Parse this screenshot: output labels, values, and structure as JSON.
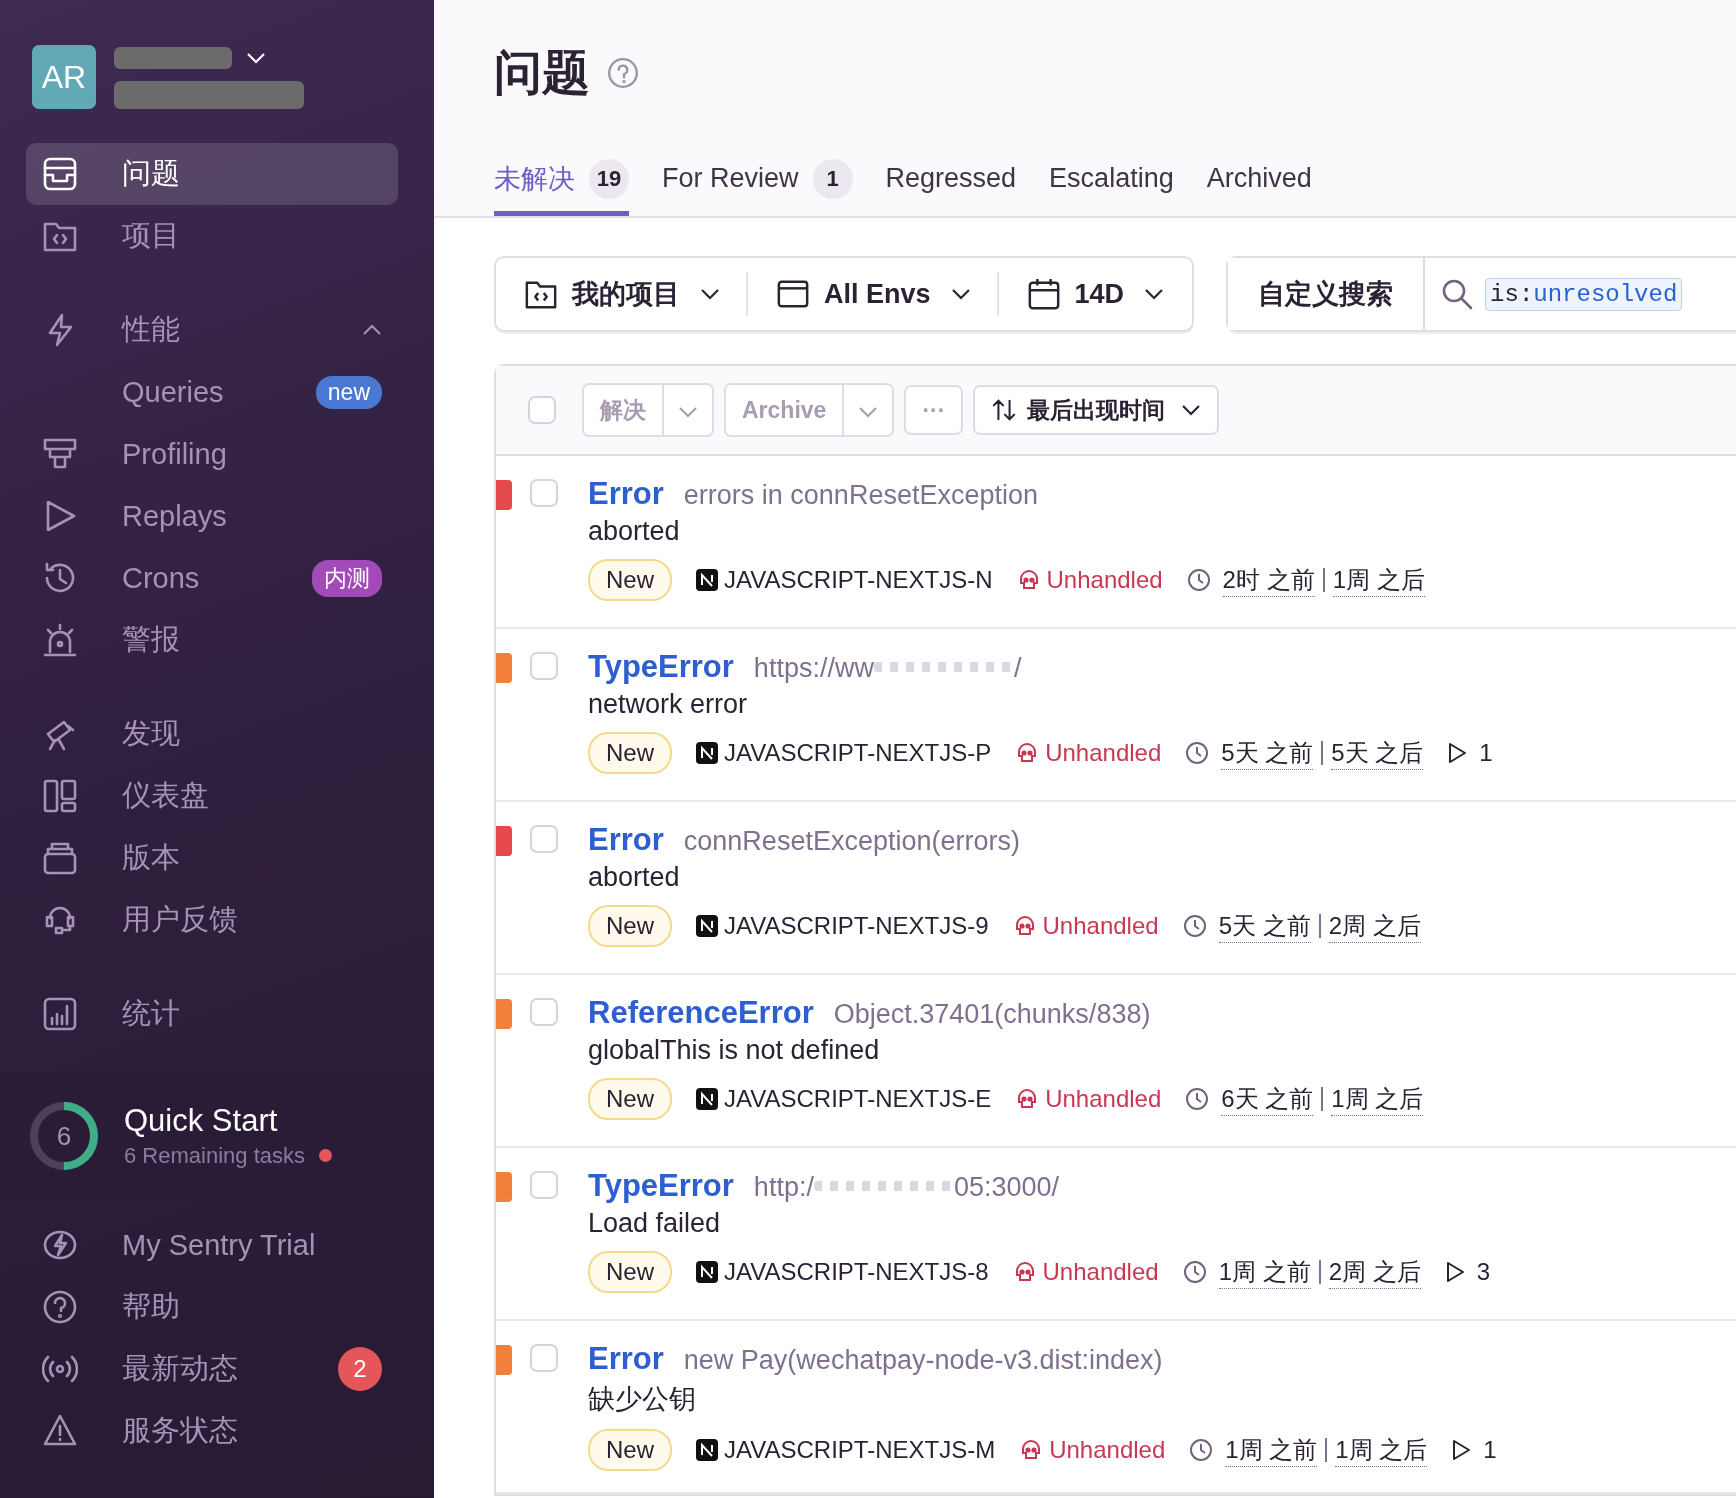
{
  "sidebar": {
    "avatar": "AR",
    "groups": [
      [
        {
          "label": "问题",
          "selected": true
        },
        {
          "label": "项目",
          "selected": false
        }
      ],
      [
        {
          "label": "性能",
          "selected": false,
          "expanded": true,
          "children": [
            {
              "label": "Queries",
              "selected": false,
              "badge": "new",
              "color": "#4a78d2"
            },
            {
              "label": "Profiling",
              "selected": false
            },
            {
              "label": "Replays",
              "selected": false
            },
            {
              "label": "Crons",
              "selected": false,
              "badge": "内测",
              "color": "#a24bb8"
            }
          ]
        },
        {
          "label": "警报",
          "selected": false
        }
      ],
      [
        {
          "label": "发现",
          "selected": false
        },
        {
          "label": "仪表盘",
          "selected": false
        },
        {
          "label": "版本",
          "selected": false
        },
        {
          "label": "用户反馈",
          "selected": false
        }
      ],
      [
        {
          "label": "统计",
          "selected": false
        }
      ]
    ],
    "quick_start": {
      "count": "6",
      "title": "Quick Start",
      "subtitle": "6 Remaining tasks",
      "unread": true
    },
    "bottom_items": [
      {
        "label": "My Sentry Trial"
      },
      {
        "label": "帮助"
      },
      {
        "label": "最新动态",
        "count": "2"
      },
      {
        "label": "服务状态"
      }
    ]
  },
  "page": {
    "title": "问题"
  },
  "tabs": [
    {
      "label": "未解决",
      "count": "19",
      "selected": true
    },
    {
      "label": "For Review",
      "count": "1",
      "selected": false
    },
    {
      "label": "Regressed",
      "selected": false
    },
    {
      "label": "Escalating",
      "selected": false
    },
    {
      "label": "Archived",
      "selected": false
    }
  ],
  "filters": {
    "project": "我的项目",
    "environment": "All Envs",
    "date_range": "14D",
    "custom_search": "自定义搜索",
    "query_key": "is:",
    "query_value": "unresolved"
  },
  "actions": {
    "select_all": false,
    "resolve": "解决",
    "archive": "Archive",
    "more": "···",
    "sort": "最后出现时间",
    "disabled": true
  },
  "issues": [
    {
      "color": "#e5484d",
      "checked": false,
      "type": "Error",
      "culprit": "errors in connResetException",
      "message": "aborted",
      "status": "New",
      "project": "JAVASCRIPT-NEXTJS-N",
      "handled": "Unhandled",
      "last_seen": "2时 之前",
      "first_seen": "1周 之后"
    },
    {
      "color": "#f0803c",
      "checked": false,
      "type": "TypeError",
      "culprit": "https://ww",
      "culprit_tail": "/",
      "message": "network error",
      "status": "New",
      "project": "JAVASCRIPT-NEXTJS-P",
      "handled": "Unhandled",
      "last_seen": "5天 之前",
      "first_seen": "5天 之后",
      "replays": "1"
    },
    {
      "color": "#e5484d",
      "checked": false,
      "type": "Error",
      "culprit": "connResetException(errors)",
      "message": "aborted",
      "status": "New",
      "project": "JAVASCRIPT-NEXTJS-9",
      "handled": "Unhandled",
      "last_seen": "5天 之前",
      "first_seen": "2周 之后"
    },
    {
      "color": "#f0803c",
      "checked": false,
      "type": "ReferenceError",
      "culprit": "Object.37401(chunks/838)",
      "message": "globalThis is not defined",
      "status": "New",
      "project": "JAVASCRIPT-NEXTJS-E",
      "handled": "Unhandled",
      "last_seen": "6天 之前",
      "first_seen": "1周 之后"
    },
    {
      "color": "#f0803c",
      "checked": false,
      "type": "TypeError",
      "culprit": "http:/",
      "culprit_tail": "05:3000/",
      "message": "Load failed",
      "status": "New",
      "project": "JAVASCRIPT-NEXTJS-8",
      "handled": "Unhandled",
      "last_seen": "1周 之前",
      "first_seen": "2周 之后",
      "replays": "3"
    },
    {
      "color": "#f0803c",
      "checked": false,
      "type": "Error",
      "culprit": "new Pay(wechatpay-node-v3.dist:index)",
      "message": "缺少公钥",
      "status": "New",
      "project": "JAVASCRIPT-NEXTJS-M",
      "handled": "Unhandled",
      "last_seen": "1周 之前",
      "first_seen": "1周 之后",
      "replays": "1"
    }
  ]
}
